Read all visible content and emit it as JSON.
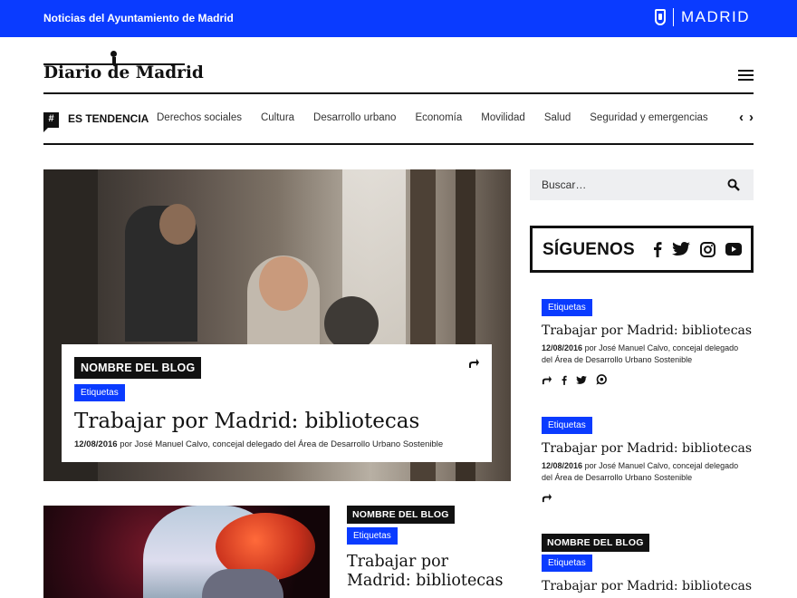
{
  "topbar": {
    "title": "Noticias del Ayuntamiento de Madrid",
    "brand": "MADRID",
    "accent": "#0a3bff"
  },
  "masthead": {
    "logo": "Diario de Madrid"
  },
  "nav": {
    "trend_label": "ES TENDENCIA",
    "items": [
      "Derechos sociales",
      "Cultura",
      "Desarrollo urbano",
      "Economía",
      "Movilidad",
      "Salud",
      "Seguridad y emergencias"
    ]
  },
  "hero": {
    "blog": "NOMBRE DEL BLOG",
    "tag": "Etiquetas",
    "headline": "Trabajar por Madrid: bibliotecas",
    "date": "12/08/2016",
    "byline": "por José Manuel Calvo, concejal delegado del Área de Desarrollo Urbano Sostenible"
  },
  "article2": {
    "blog": "NOMBRE DEL BLOG",
    "tag": "Etiquetas",
    "headline": "Trabajar por Madrid: bibliotecas"
  },
  "sidebar": {
    "search_placeholder": "Buscar…",
    "follow_label": "SÍGUENOS",
    "items": [
      {
        "tag": "Etiquetas",
        "headline": "Trabajar por Madrid: bibliotecas",
        "date": "12/08/2016",
        "byline": "por José Manuel Calvo, concejal delegado del Área de Desarrollo Urbano Sostenible"
      },
      {
        "tag": "Etiquetas",
        "headline": "Trabajar por Madrid: bibliotecas",
        "date": "12/08/2016",
        "byline": "por José Manuel Calvo, concejal delegado del Área de Desarrollo Urbano Sostenible"
      },
      {
        "blog": "NOMBRE DEL BLOG",
        "tag": "Etiquetas",
        "headline": "Trabajar por Madrid: bibliotecas"
      }
    ]
  },
  "icons": {
    "trend": "hashtag-icon",
    "menu": "hamburger-menu-icon",
    "search": "search-icon",
    "share": "share-icon",
    "social": [
      "facebook-icon",
      "twitter-icon",
      "instagram-icon",
      "youtube-icon",
      "whatsapp-icon"
    ]
  }
}
